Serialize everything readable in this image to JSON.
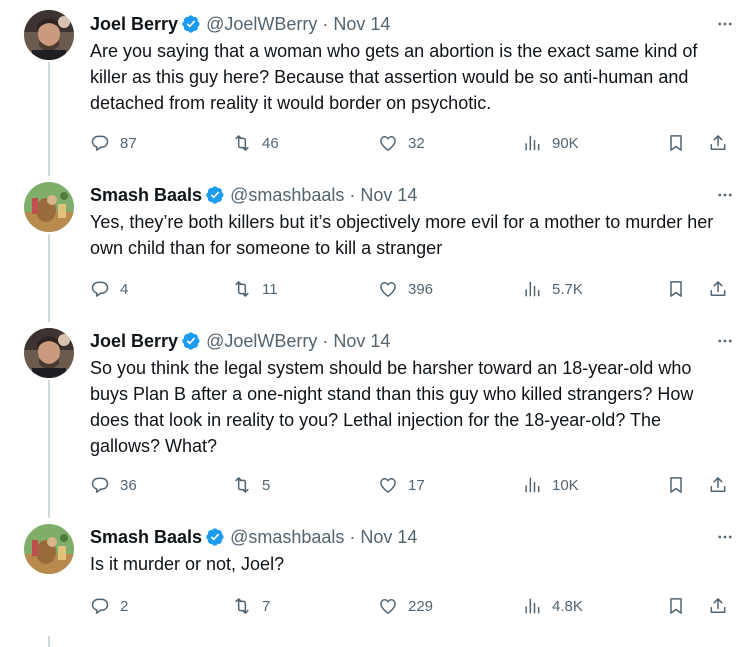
{
  "tweets": [
    {
      "name": "Joel Berry",
      "handle": "@JoelWBerry",
      "separator": "·",
      "date": "Nov 14",
      "text": "Are you saying that a woman who gets an abortion is the exact same kind of killer as this guy here? Because that assertion would be so anti-human and detached from reality it would border on psychotic.",
      "replies": "87",
      "retweets": "46",
      "likes": "32",
      "views": "90K"
    },
    {
      "name": "Smash Baals",
      "handle": "@smashbaals",
      "separator": "·",
      "date": "Nov 14",
      "text": "Yes, they’re both killers but it’s objectively more evil for a mother to murder her own child than for someone to kill a stranger",
      "replies": "4",
      "retweets": "11",
      "likes": "396",
      "views": "5.7K"
    },
    {
      "name": "Joel Berry",
      "handle": "@JoelWBerry",
      "separator": "·",
      "date": "Nov 14",
      "text": "So you think the legal system should be harsher toward an 18-year-old who buys Plan B after a one-night stand than this guy who killed strangers? How does that look in reality to you? Lethal injection for the 18-year-old? The gallows? What?",
      "replies": "36",
      "retweets": "5",
      "likes": "17",
      "views": "10K"
    },
    {
      "name": "Smash Baals",
      "handle": "@smashbaals",
      "separator": "·",
      "date": "Nov 14",
      "text": "Is it murder or not, Joel?",
      "replies": "2",
      "retweets": "7",
      "likes": "229",
      "views": "4.8K"
    }
  ],
  "colors": {
    "verified": "#1d9bf0",
    "secondary_text": "#536471",
    "primary_text": "#0f1419",
    "thread_line": "#cfd9de"
  },
  "icons": [
    "verified-badge-icon",
    "more-icon",
    "reply-icon",
    "retweet-icon",
    "like-icon",
    "views-icon",
    "bookmark-icon",
    "share-icon"
  ]
}
